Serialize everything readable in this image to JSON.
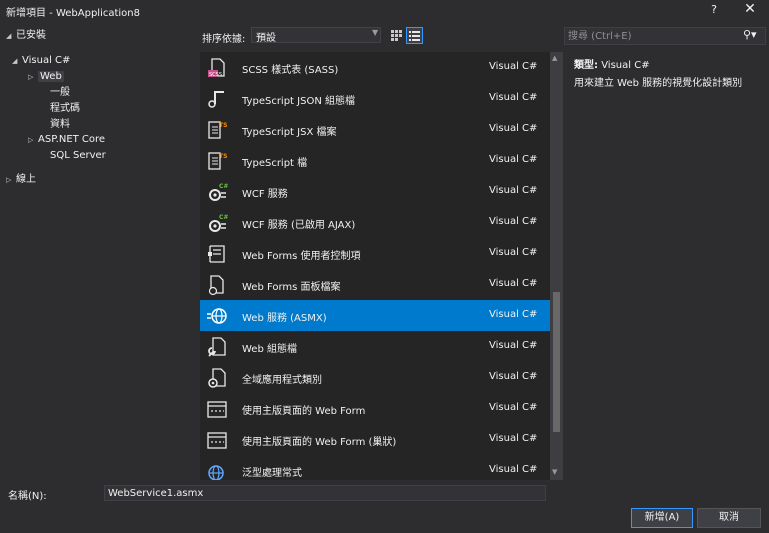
{
  "window": {
    "title": "新增項目 - WebApplication8",
    "help": "?",
    "close": "✕"
  },
  "tree": [
    {
      "label": "已安裝",
      "arrow": "◢",
      "level": 0
    },
    {
      "label": "Visual C#",
      "arrow": "◢",
      "level": 1
    },
    {
      "label": "Web",
      "arrow": "▷",
      "level": 2,
      "selected": true
    },
    {
      "label": "一般",
      "arrow": "",
      "level": 3
    },
    {
      "label": "程式碼",
      "arrow": "",
      "level": 3
    },
    {
      "label": "資料",
      "arrow": "",
      "level": 3
    },
    {
      "label": "ASP.NET Core",
      "arrow": "▷",
      "level": 2
    },
    {
      "label": "SQL Server",
      "arrow": "",
      "level": 3
    },
    {
      "label": "線上",
      "arrow": "▷",
      "level": 0
    }
  ],
  "sort": {
    "label": "排序依據:",
    "value": "預設"
  },
  "search": {
    "placeholder": "搜尋 (Ctrl+E)"
  },
  "items": [
    {
      "name": "SCSS 樣式表 (SASS)",
      "lang": "Visual C#",
      "icon": "scss-file-icon"
    },
    {
      "name": "TypeScript JSON 組態檔",
      "lang": "Visual C#",
      "icon": "json-config-icon"
    },
    {
      "name": "TypeScript JSX 檔案",
      "lang": "Visual C#",
      "icon": "typescript-jsx-icon"
    },
    {
      "name": "TypeScript 檔",
      "lang": "Visual C#",
      "icon": "typescript-file-icon"
    },
    {
      "name": "WCF 服務",
      "lang": "Visual C#",
      "icon": "wcf-service-icon"
    },
    {
      "name": "WCF 服務 (已啟用 AJAX)",
      "lang": "Visual C#",
      "icon": "wcf-ajax-service-icon"
    },
    {
      "name": "Web Forms 使用者控制項",
      "lang": "Visual C#",
      "icon": "user-control-icon"
    },
    {
      "name": "Web Forms 面板檔案",
      "lang": "Visual C#",
      "icon": "skin-file-icon"
    },
    {
      "name": "Web 服務 (ASMX)",
      "lang": "Visual C#",
      "icon": "web-service-icon",
      "selected": true
    },
    {
      "name": "Web 組態檔",
      "lang": "Visual C#",
      "icon": "web-config-icon"
    },
    {
      "name": "全域應用程式類別",
      "lang": "Visual C#",
      "icon": "global-class-icon"
    },
    {
      "name": "使用主版頁面的 Web Form",
      "lang": "Visual C#",
      "icon": "master-page-form-icon"
    },
    {
      "name": "使用主版頁面的 Web Form (巢狀)",
      "lang": "Visual C#",
      "icon": "nested-master-form-icon"
    },
    {
      "name": "泛型處理常式",
      "lang": "Visual C#",
      "icon": "generic-handler-icon"
    }
  ],
  "details": {
    "type_label": "類型:",
    "type_value": "Visual C#",
    "description": "用來建立 Web 服務的視覺化設計類別"
  },
  "name_field": {
    "label": "名稱(N):",
    "value": "WebService1.asmx"
  },
  "buttons": {
    "add": "新增(A)",
    "cancel": "取消"
  },
  "colors": {
    "accent": "#007acc",
    "background": "#2d2d30",
    "list_bg": "#252526",
    "text": "#f1f1f1"
  }
}
